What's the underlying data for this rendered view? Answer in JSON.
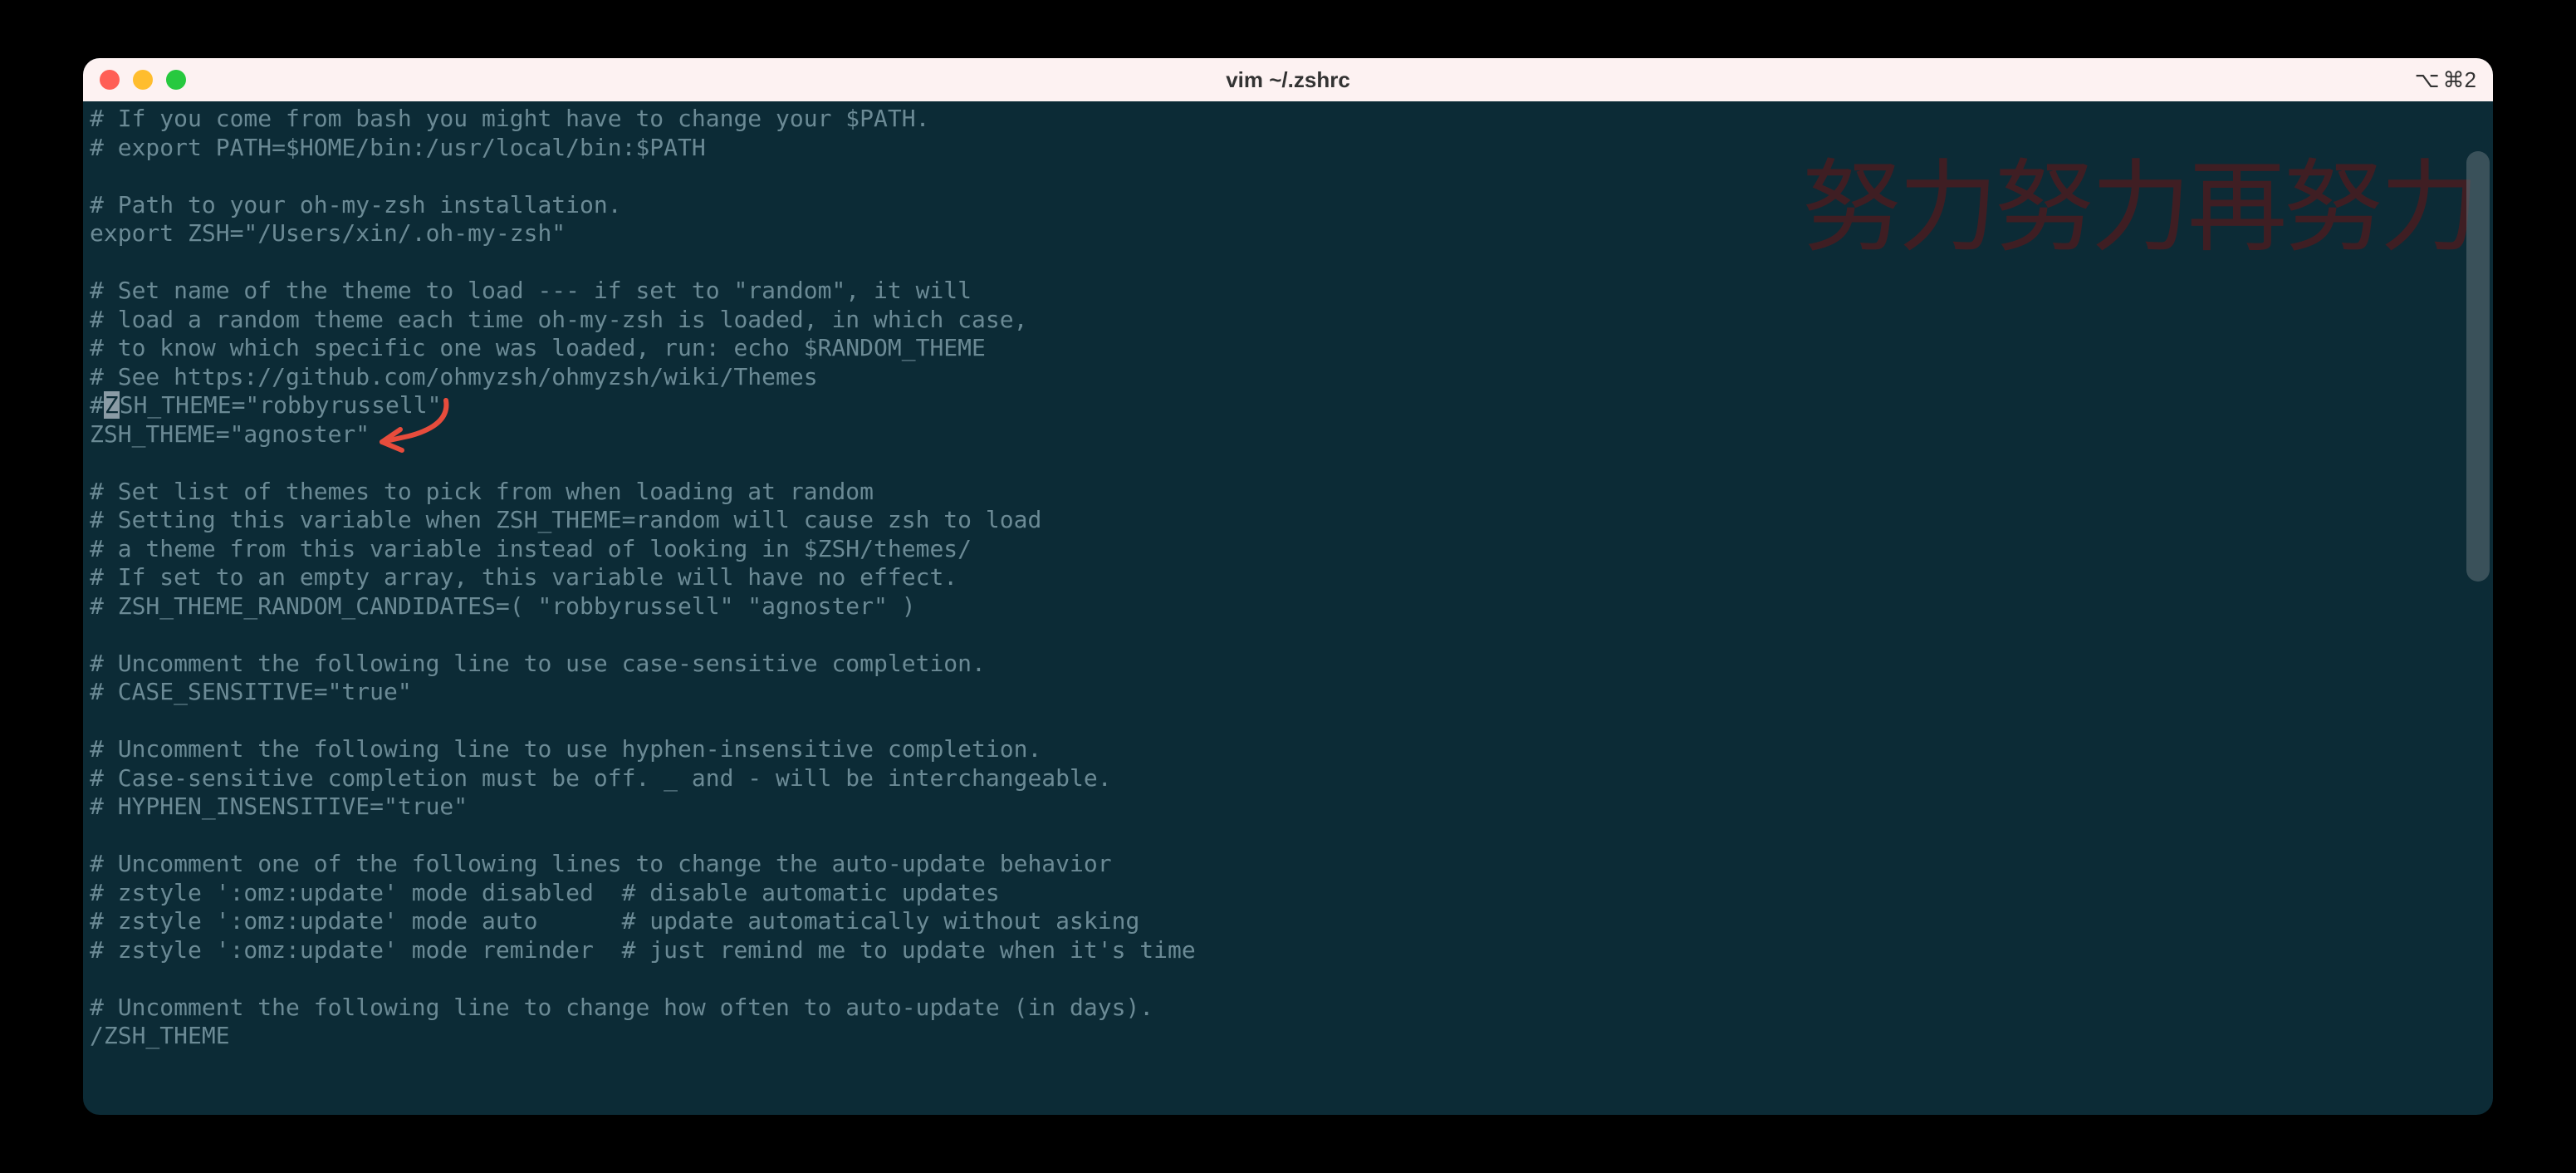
{
  "window": {
    "title": "vim ~/.zshrc",
    "pane_indicator": "⌘2",
    "option_icon": "⌥"
  },
  "watermark": "努力努力再努力",
  "lines": [
    "# If you come from bash you might have to change your $PATH.",
    "# export PATH=$HOME/bin:/usr/local/bin:$PATH",
    "",
    "# Path to your oh-my-zsh installation.",
    "export ZSH=\"/Users/xin/.oh-my-zsh\"",
    "",
    "# Set name of the theme to load --- if set to \"random\", it will",
    "# load a random theme each time oh-my-zsh is loaded, in which case,",
    "# to know which specific one was loaded, run: echo $RANDOM_THEME",
    "# See https://github.com/ohmyzsh/ohmyzsh/wiki/Themes",
    "#ZSH_THEME=\"robbyrussell\"",
    "ZSH_THEME=\"agnoster\"",
    "",
    "# Set list of themes to pick from when loading at random",
    "# Setting this variable when ZSH_THEME=random will cause zsh to load",
    "# a theme from this variable instead of looking in $ZSH/themes/",
    "# If set to an empty array, this variable will have no effect.",
    "# ZSH_THEME_RANDOM_CANDIDATES=( \"robbyrussell\" \"agnoster\" )",
    "",
    "# Uncomment the following line to use case-sensitive completion.",
    "# CASE_SENSITIVE=\"true\"",
    "",
    "# Uncomment the following line to use hyphen-insensitive completion.",
    "# Case-sensitive completion must be off. _ and - will be interchangeable.",
    "# HYPHEN_INSENSITIVE=\"true\"",
    "",
    "# Uncomment one of the following lines to change the auto-update behavior",
    "# zstyle ':omz:update' mode disabled  # disable automatic updates",
    "# zstyle ':omz:update' mode auto      # update automatically without asking",
    "# zstyle ':omz:update' mode reminder  # just remind me to update when it's time",
    "",
    "# Uncomment the following line to change how often to auto-update (in days)."
  ],
  "cursor_line_prefix": "#",
  "cursor_char": "Z",
  "cursor_line_suffix": "SH_THEME=\"robbyrussell\"",
  "cursor_line_index": 10,
  "search_line": "/ZSH_THEME"
}
